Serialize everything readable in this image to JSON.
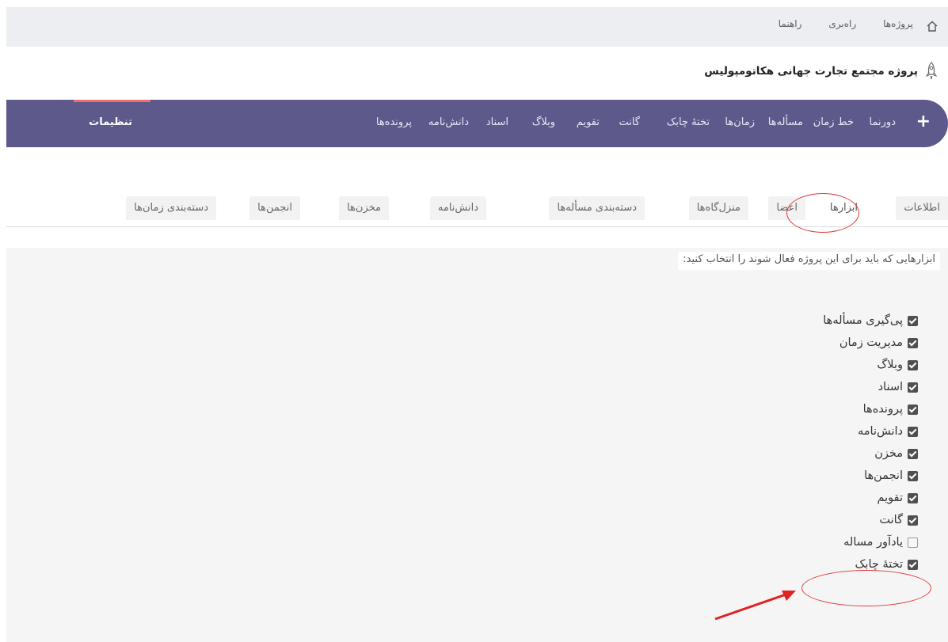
{
  "topbar": {
    "home_icon": "home-icon",
    "links": [
      "پروژه‌ها",
      "راه‌بری",
      "راهنما"
    ]
  },
  "project": {
    "icon": "rocket-icon",
    "title": "پروژه مجتمع تجارت جهانی هکاتومپولیس"
  },
  "mainnav": {
    "plus_label": "+",
    "items": [
      "دورنما",
      "خط زمان",
      "مسأله‌ها",
      "زمان‌ها",
      "تختهٔ چابک",
      "گانت",
      "تقویم",
      "وبلاگ",
      "اسناد",
      "دانش‌نامه",
      "پرونده‌ها",
      "تنظیمات"
    ],
    "active_item": "تنظیمات"
  },
  "tabs": {
    "items": [
      "اطلاعات",
      "ابزارها",
      "اعضا",
      "منزل‌گاه‌ها",
      "دسته‌بندی مسأله‌ها",
      "دانش‌نامه",
      "مخزن‌ها",
      "انجمن‌ها",
      "دسته‌بندی زمان‌ها"
    ],
    "active": "ابزارها"
  },
  "tools": {
    "legend": "ابزارهایی که باید برای این پروژه فعال شوند را انتخاب کنید:",
    "options": [
      {
        "label": "پی‌گیری مسأله‌ها",
        "checked": true
      },
      {
        "label": "مدیریت زمان",
        "checked": true
      },
      {
        "label": "وبلاگ",
        "checked": true
      },
      {
        "label": "اسناد",
        "checked": true
      },
      {
        "label": "پرونده‌ها",
        "checked": true
      },
      {
        "label": "دانش‌نامه",
        "checked": true
      },
      {
        "label": "مخزن",
        "checked": true
      },
      {
        "label": "انجمن‌ها",
        "checked": true
      },
      {
        "label": "تقویم",
        "checked": true
      },
      {
        "label": "گانت",
        "checked": true
      },
      {
        "label": "یادآور مساله",
        "checked": false
      },
      {
        "label": "تختهٔ چابک",
        "checked": true
      }
    ]
  },
  "colors": {
    "nav_bg": "#5d5a8b",
    "active_indicator": "#ef6d6d",
    "annotation": "#e23a3a"
  }
}
